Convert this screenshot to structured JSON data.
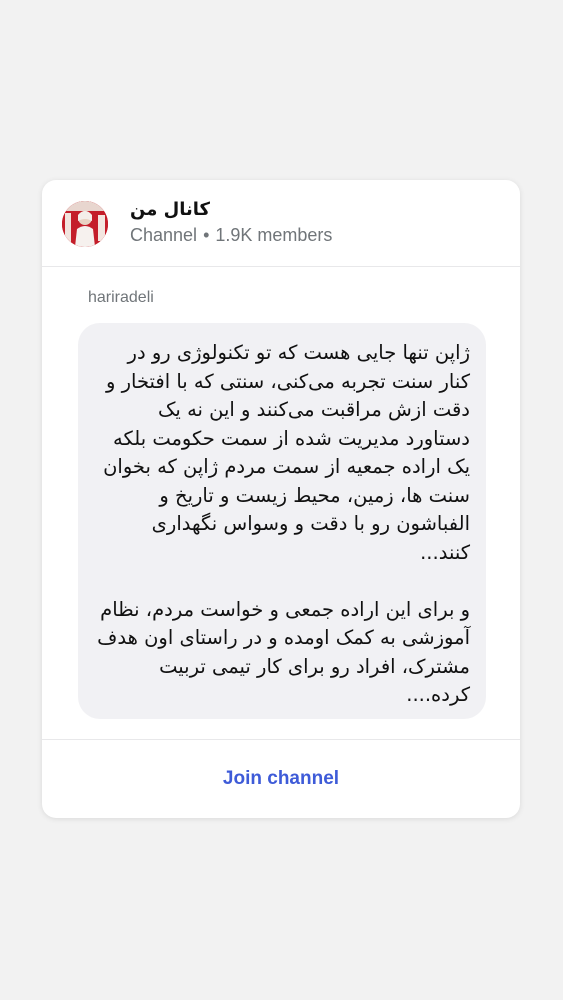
{
  "channel": {
    "name": "کانال من",
    "type_label": "Channel",
    "separator": "•",
    "members": "1.9K members",
    "avatar_icon": "channel-avatar-icon"
  },
  "message": {
    "sender": "hariradeli",
    "text": "ژاپن تنها جایی هست که تو تکنولوژی رو در کنار سنت تجربه می‌کنی، سنتی که با افتخار و دقت ازش مراقبت می‌کنند و این نه یک دستاورد مدیریت شده از سمت حکومت بلکه یک اراده جمعیه از سمت مردم ژاپن که بخوان سنت ها، زمین، محیط زیست و تاریخ و الفباشون رو با دقت و وسواس نگهداری کنند...\n\nو برای این اراده جمعی و خواست مردم، نظام آموزشی به کمک اومده و در راستای اون هدف مشترک، افراد رو برای کار تیمی تربیت کرده...."
  },
  "footer": {
    "join_label": "Join channel"
  },
  "colors": {
    "background": "#f2f2f2",
    "card": "#ffffff",
    "bubble": "#f1f1f4",
    "accent": "#3e5bd8",
    "muted": "#707579"
  }
}
